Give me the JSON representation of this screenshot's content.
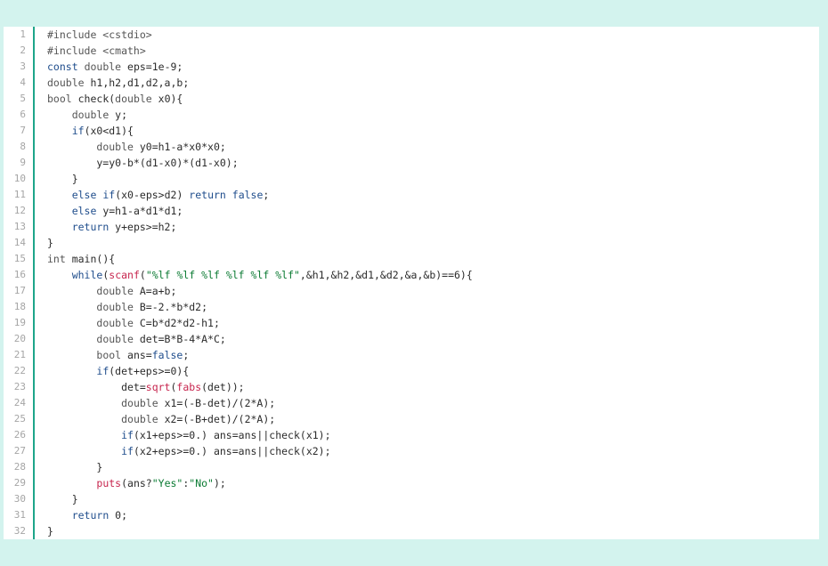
{
  "colors": {
    "background": "#d3f3ee",
    "panel": "#ffffff",
    "gutter_border": "#1ea58a",
    "line_number": "#a5a5a5",
    "text": "#2b2b2b",
    "keyword": "#1f4d8c",
    "type": "#555555",
    "preprocessor": "#555555",
    "function": "#c7254e",
    "string": "#0a7a32"
  },
  "lines": [
    {
      "no": "1",
      "tokens": [
        {
          "t": "pp",
          "v": "#include <cstdio>"
        }
      ]
    },
    {
      "no": "2",
      "tokens": [
        {
          "t": "pp",
          "v": "#include <cmath>"
        }
      ]
    },
    {
      "no": "3",
      "tokens": [
        {
          "t": "kw",
          "v": "const"
        },
        {
          "t": "text",
          "v": " "
        },
        {
          "t": "type",
          "v": "double"
        },
        {
          "t": "text",
          "v": " eps=1e-9;"
        }
      ]
    },
    {
      "no": "4",
      "tokens": [
        {
          "t": "type",
          "v": "double"
        },
        {
          "t": "text",
          "v": " h1,h2,d1,d2,a,b;"
        }
      ]
    },
    {
      "no": "5",
      "tokens": [
        {
          "t": "type",
          "v": "bool"
        },
        {
          "t": "text",
          "v": " check("
        },
        {
          "t": "type",
          "v": "double"
        },
        {
          "t": "text",
          "v": " x0){"
        }
      ]
    },
    {
      "no": "6",
      "tokens": [
        {
          "t": "text",
          "v": "    "
        },
        {
          "t": "type",
          "v": "double"
        },
        {
          "t": "text",
          "v": " y;"
        }
      ]
    },
    {
      "no": "7",
      "tokens": [
        {
          "t": "text",
          "v": "    "
        },
        {
          "t": "kw",
          "v": "if"
        },
        {
          "t": "text",
          "v": "(x0<d1){"
        }
      ]
    },
    {
      "no": "8",
      "tokens": [
        {
          "t": "text",
          "v": "        "
        },
        {
          "t": "type",
          "v": "double"
        },
        {
          "t": "text",
          "v": " y0=h1-a*x0*x0;"
        }
      ]
    },
    {
      "no": "9",
      "tokens": [
        {
          "t": "text",
          "v": "        y=y0-b*(d1-x0)*(d1-x0);"
        }
      ]
    },
    {
      "no": "10",
      "tokens": [
        {
          "t": "text",
          "v": "    }"
        }
      ]
    },
    {
      "no": "11",
      "tokens": [
        {
          "t": "text",
          "v": "    "
        },
        {
          "t": "kw",
          "v": "else"
        },
        {
          "t": "text",
          "v": " "
        },
        {
          "t": "kw",
          "v": "if"
        },
        {
          "t": "text",
          "v": "(x0-eps>d2) "
        },
        {
          "t": "kw",
          "v": "return"
        },
        {
          "t": "text",
          "v": " "
        },
        {
          "t": "kw",
          "v": "false"
        },
        {
          "t": "text",
          "v": ";"
        }
      ]
    },
    {
      "no": "12",
      "tokens": [
        {
          "t": "text",
          "v": "    "
        },
        {
          "t": "kw",
          "v": "else"
        },
        {
          "t": "text",
          "v": " y=h1-a*d1*d1;"
        }
      ]
    },
    {
      "no": "13",
      "tokens": [
        {
          "t": "text",
          "v": "    "
        },
        {
          "t": "kw",
          "v": "return"
        },
        {
          "t": "text",
          "v": " y+eps>=h2;"
        }
      ]
    },
    {
      "no": "14",
      "tokens": [
        {
          "t": "text",
          "v": "}"
        }
      ]
    },
    {
      "no": "15",
      "tokens": [
        {
          "t": "type",
          "v": "int"
        },
        {
          "t": "text",
          "v": " main(){"
        }
      ]
    },
    {
      "no": "16",
      "tokens": [
        {
          "t": "text",
          "v": "    "
        },
        {
          "t": "kw",
          "v": "while"
        },
        {
          "t": "text",
          "v": "("
        },
        {
          "t": "fn",
          "v": "scanf"
        },
        {
          "t": "text",
          "v": "("
        },
        {
          "t": "str",
          "v": "\"%lf %lf %lf %lf %lf %lf\""
        },
        {
          "t": "text",
          "v": ",&h1,&h2,&d1,&d2,&a,&b)==6){"
        }
      ]
    },
    {
      "no": "17",
      "tokens": [
        {
          "t": "text",
          "v": "        "
        },
        {
          "t": "type",
          "v": "double"
        },
        {
          "t": "text",
          "v": " A=a+b;"
        }
      ]
    },
    {
      "no": "18",
      "tokens": [
        {
          "t": "text",
          "v": "        "
        },
        {
          "t": "type",
          "v": "double"
        },
        {
          "t": "text",
          "v": " B=-2.*b*d2;"
        }
      ]
    },
    {
      "no": "19",
      "tokens": [
        {
          "t": "text",
          "v": "        "
        },
        {
          "t": "type",
          "v": "double"
        },
        {
          "t": "text",
          "v": " C=b*d2*d2-h1;"
        }
      ]
    },
    {
      "no": "20",
      "tokens": [
        {
          "t": "text",
          "v": "        "
        },
        {
          "t": "type",
          "v": "double"
        },
        {
          "t": "text",
          "v": " det=B*B-4*A*C;"
        }
      ]
    },
    {
      "no": "21",
      "tokens": [
        {
          "t": "text",
          "v": "        "
        },
        {
          "t": "type",
          "v": "bool"
        },
        {
          "t": "text",
          "v": " ans="
        },
        {
          "t": "kw",
          "v": "false"
        },
        {
          "t": "text",
          "v": ";"
        }
      ]
    },
    {
      "no": "22",
      "tokens": [
        {
          "t": "text",
          "v": "        "
        },
        {
          "t": "kw",
          "v": "if"
        },
        {
          "t": "text",
          "v": "(det+eps>=0){"
        }
      ]
    },
    {
      "no": "23",
      "tokens": [
        {
          "t": "text",
          "v": "            det="
        },
        {
          "t": "fn",
          "v": "sqrt"
        },
        {
          "t": "text",
          "v": "("
        },
        {
          "t": "fn",
          "v": "fabs"
        },
        {
          "t": "text",
          "v": "(det));"
        }
      ]
    },
    {
      "no": "24",
      "tokens": [
        {
          "t": "text",
          "v": "            "
        },
        {
          "t": "type",
          "v": "double"
        },
        {
          "t": "text",
          "v": " x1=(-B-det)/(2*A);"
        }
      ]
    },
    {
      "no": "25",
      "tokens": [
        {
          "t": "text",
          "v": "            "
        },
        {
          "t": "type",
          "v": "double"
        },
        {
          "t": "text",
          "v": " x2=(-B+det)/(2*A);"
        }
      ]
    },
    {
      "no": "26",
      "tokens": [
        {
          "t": "text",
          "v": "            "
        },
        {
          "t": "kw",
          "v": "if"
        },
        {
          "t": "text",
          "v": "(x1+eps>=0.) ans=ans||check(x1);"
        }
      ]
    },
    {
      "no": "27",
      "tokens": [
        {
          "t": "text",
          "v": "            "
        },
        {
          "t": "kw",
          "v": "if"
        },
        {
          "t": "text",
          "v": "(x2+eps>=0.) ans=ans||check(x2);"
        }
      ]
    },
    {
      "no": "28",
      "tokens": [
        {
          "t": "text",
          "v": "        }"
        }
      ]
    },
    {
      "no": "29",
      "tokens": [
        {
          "t": "text",
          "v": "        "
        },
        {
          "t": "fn",
          "v": "puts"
        },
        {
          "t": "text",
          "v": "(ans?"
        },
        {
          "t": "str",
          "v": "\"Yes\""
        },
        {
          "t": "text",
          "v": ":"
        },
        {
          "t": "str",
          "v": "\"No\""
        },
        {
          "t": "text",
          "v": ");"
        }
      ]
    },
    {
      "no": "30",
      "tokens": [
        {
          "t": "text",
          "v": "    }"
        }
      ]
    },
    {
      "no": "31",
      "tokens": [
        {
          "t": "text",
          "v": "    "
        },
        {
          "t": "kw",
          "v": "return"
        },
        {
          "t": "text",
          "v": " 0;"
        }
      ]
    },
    {
      "no": "32",
      "tokens": [
        {
          "t": "text",
          "v": "}"
        }
      ]
    }
  ]
}
